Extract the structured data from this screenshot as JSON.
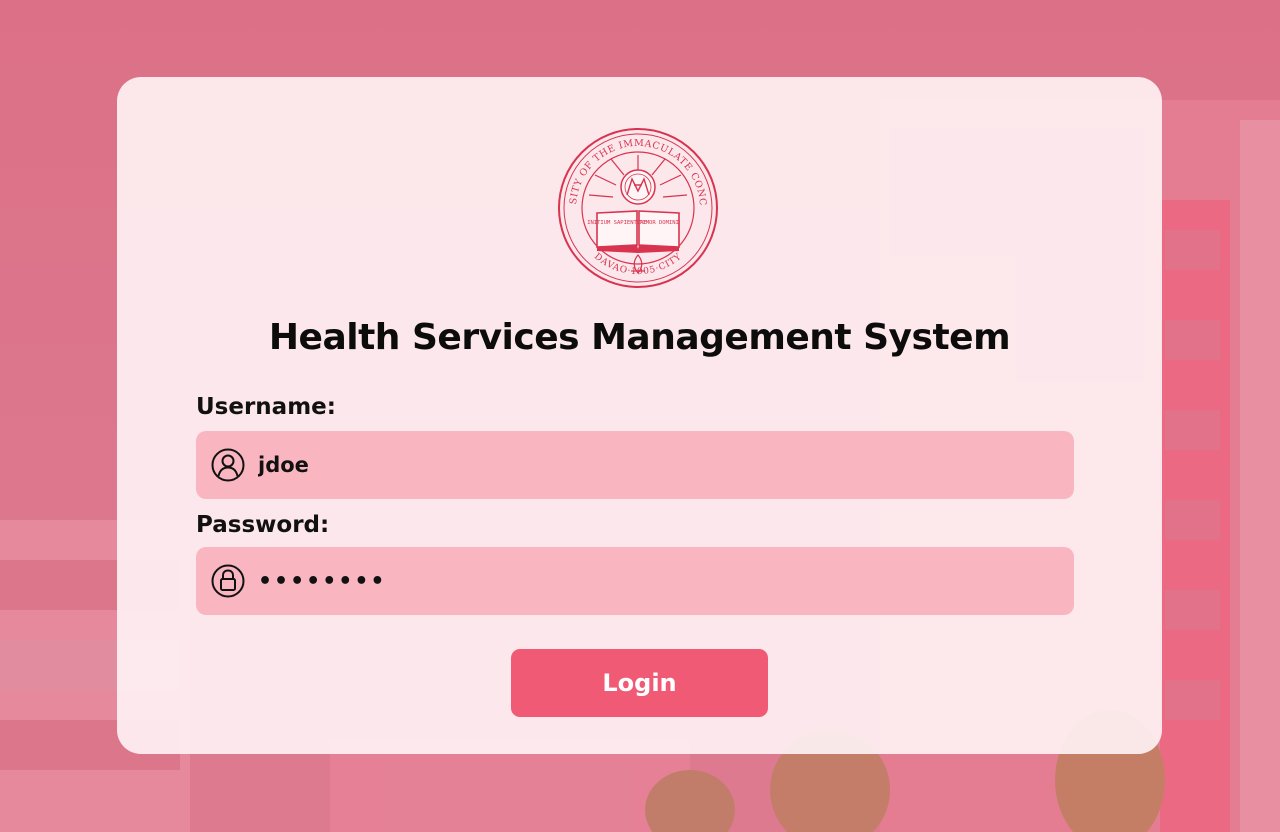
{
  "app": {
    "title": "Health Services Management System"
  },
  "logo": {
    "ring_text_top": "UNIVERSITY OF THE IMMACULATE CONCEPTION",
    "ring_text_bottom": "DAVAO·1905·CITY",
    "book_left": "INITIUM SAPIENTIAE",
    "book_right": "TIMOR DOMINI"
  },
  "form": {
    "username_label": "Username:",
    "username_value": "jdoe",
    "username_icon": "user-icon",
    "password_label": "Password:",
    "password_value": "secretpw",
    "password_icon": "lock-icon",
    "login_label": "Login"
  },
  "colors": {
    "accent": "#f05a75",
    "field_bg": "#f9b6c1",
    "seal": "#d8344f",
    "background": "#d8788a"
  }
}
